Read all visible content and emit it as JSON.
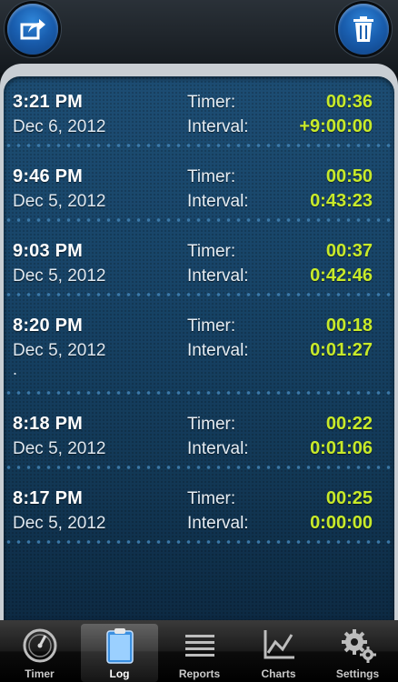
{
  "entries": [
    {
      "time": "3:21 PM",
      "date": "Dec 6, 2012",
      "timer_label": "Timer:",
      "timer": "00:36",
      "interval_label": "Interval:",
      "interval": "+9:00:00",
      "note": ""
    },
    {
      "time": "9:46 PM",
      "date": "Dec 5, 2012",
      "timer_label": "Timer:",
      "timer": "00:50",
      "interval_label": "Interval:",
      "interval": "0:43:23",
      "note": ""
    },
    {
      "time": "9:03 PM",
      "date": "Dec 5, 2012",
      "timer_label": "Timer:",
      "timer": "00:37",
      "interval_label": "Interval:",
      "interval": "0:42:46",
      "note": ""
    },
    {
      "time": "8:20 PM",
      "date": "Dec 5, 2012",
      "timer_label": "Timer:",
      "timer": "00:18",
      "interval_label": "Interval:",
      "interval": "0:01:27",
      "note": "."
    },
    {
      "time": "8:18 PM",
      "date": "Dec 5, 2012",
      "timer_label": "Timer:",
      "timer": "00:22",
      "interval_label": "Interval:",
      "interval": "0:01:06",
      "note": ""
    },
    {
      "time": "8:17 PM",
      "date": "Dec 5, 2012",
      "timer_label": "Timer:",
      "timer": "00:25",
      "interval_label": "Interval:",
      "interval": "0:00:00",
      "note": ""
    }
  ],
  "tabs": [
    {
      "label": "Timer",
      "icon": "stopwatch-icon"
    },
    {
      "label": "Log",
      "icon": "clipboard-icon"
    },
    {
      "label": "Reports",
      "icon": "list-icon"
    },
    {
      "label": "Charts",
      "icon": "chart-icon"
    },
    {
      "label": "Settings",
      "icon": "gear-icon"
    }
  ],
  "active_tab": "Log",
  "colors": {
    "accent_value": "#c8ea2a",
    "list_bg": "#174366",
    "button_blue": "#1a5fb0"
  }
}
